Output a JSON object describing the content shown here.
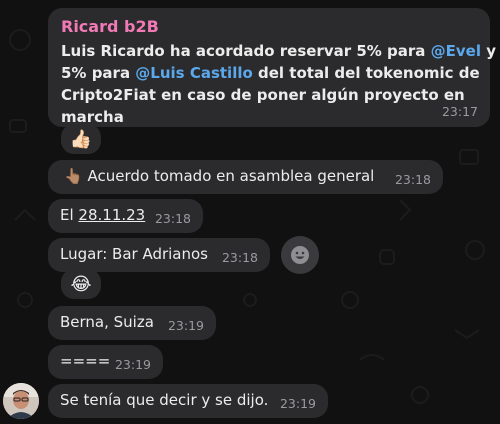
{
  "chat": {
    "sender_name": "Ricard b2B",
    "messages": [
      {
        "line1_pre": "Luis Ricardo ha acordado reservar 5% para ",
        "line1_mention": "@Evel",
        "line1_post": " y",
        "line2_pre": "5% para ",
        "line2_mention": "@Luis Castillo",
        "line2_post": " del total del tokenomic de",
        "line3": "Cripto2Fiat en caso de poner algún proyecto en",
        "line4": "marcha",
        "time": "23:17"
      },
      {
        "text": "Acuerdo tomado en asamblea general",
        "emoji": "👆🏽",
        "time": "23:18"
      },
      {
        "prefix": "El ",
        "date": "28.11.23",
        "time": "23:18"
      },
      {
        "text": "Lugar: Bar Adrianos",
        "time": "23:18"
      },
      {
        "text": "Berna, Suiza",
        "time": "23:19"
      },
      {
        "text": "====",
        "time": "23:19"
      },
      {
        "text": "Se tenía que decir y se dijo.",
        "time": "23:19"
      }
    ],
    "reactions": {
      "thumbs_up": "👍🏻",
      "laughing": "😂",
      "react_button": "smiley-icon"
    }
  }
}
